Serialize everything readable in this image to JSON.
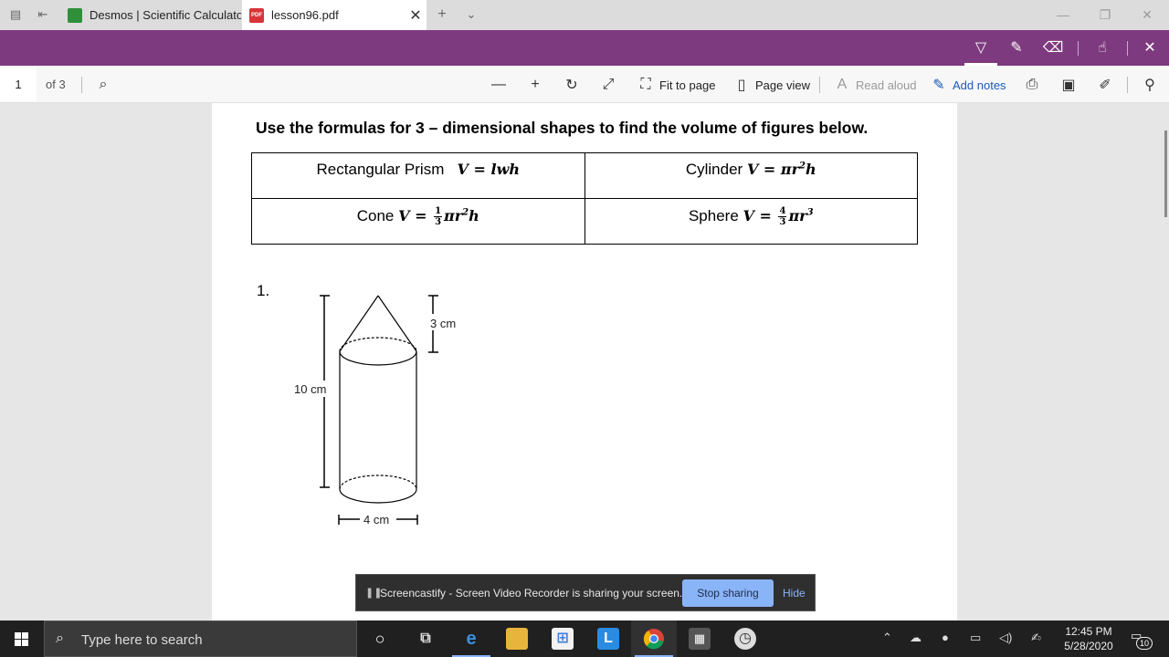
{
  "browser": {
    "tabs": [
      {
        "label": "Desmos | Scientific Calculator",
        "icon": "desmos-icon"
      },
      {
        "label": "lesson96.pdf",
        "icon": "pdf-icon",
        "active": true
      }
    ],
    "fav_pdf_text": "PDF"
  },
  "pdf_toolbar": {
    "page_number": "1",
    "page_of": "of 3",
    "fit_to_page": "Fit to page",
    "page_view": "Page view",
    "read_aloud": "Read aloud",
    "add_notes": "Add notes"
  },
  "document": {
    "heading": "Use the formulas for 3 – dimensional shapes to find the volume of figures below.",
    "formulas": {
      "rect_prism_label": "Rectangular Prism",
      "rect_prism_formula": "V = lwh",
      "cylinder_label": "Cylinder",
      "cylinder_formula_pre": "V = πr",
      "cylinder_formula_post": "h",
      "cone_label": "Cone",
      "cone_formula_lhs": "V =",
      "cone_frac_num": "1",
      "cone_frac_den": "3",
      "cone_formula_rhs_pre": "πr",
      "cone_formula_rhs_post": "h",
      "sphere_label": "Sphere",
      "sphere_formula_lhs": "V =",
      "sphere_frac_num": "4",
      "sphere_frac_den": "3",
      "sphere_formula_rhs_pre": "πr",
      "sphere_exp": "3",
      "square_exp": "2"
    },
    "question_number": "1.",
    "figure": {
      "total_height_label": "10 cm",
      "cone_height_label": "3 cm",
      "diameter_label": "4 cm"
    }
  },
  "notice": {
    "text": "Screencastify - Screen Video Recorder is sharing your screen.",
    "stop_label": "Stop sharing",
    "hide_label": "Hide"
  },
  "taskbar": {
    "search_placeholder": "Type here to search",
    "clock_time": "12:45 PM",
    "clock_date": "5/28/2020",
    "notification_count": "10",
    "accent_color": "#7e3a7f"
  }
}
